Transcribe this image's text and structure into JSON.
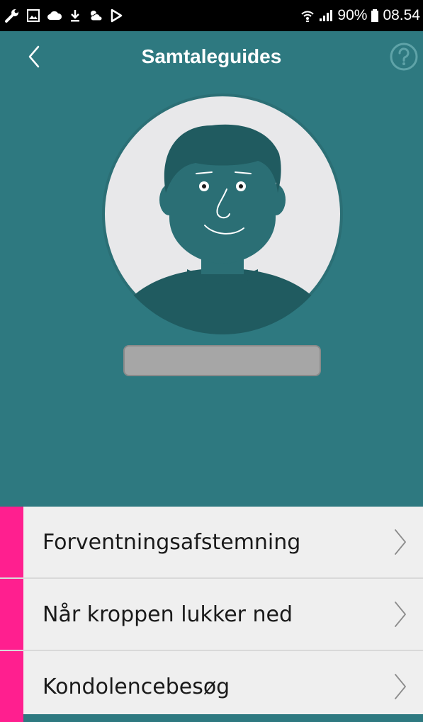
{
  "status_bar": {
    "battery": "90%",
    "time": "08.54",
    "icons": [
      "wrench-icon",
      "image-icon",
      "cloud-icon",
      "download-icon",
      "weather-icon",
      "play-store-icon",
      "wifi-icon",
      "signal-icon",
      "battery-icon"
    ]
  },
  "header": {
    "title": "Samtaleguides",
    "back_icon": "chevron-left-icon",
    "help_icon": "help-icon"
  },
  "profile": {
    "avatar_icon": "avatar-illustration",
    "name_field_value": ""
  },
  "guides": {
    "items": [
      {
        "label": "Forventningsafstemning",
        "icon": "chevron-right-icon"
      },
      {
        "label": "Når kroppen lukker ned",
        "icon": "chevron-right-icon"
      },
      {
        "label": "Kondolencebesøg",
        "icon": "chevron-right-icon"
      }
    ]
  },
  "colors": {
    "header_bg": "#2e7980",
    "accent": "#ff1f8f",
    "list_bg": "#efefef",
    "status_bar_bg": "#000000"
  }
}
